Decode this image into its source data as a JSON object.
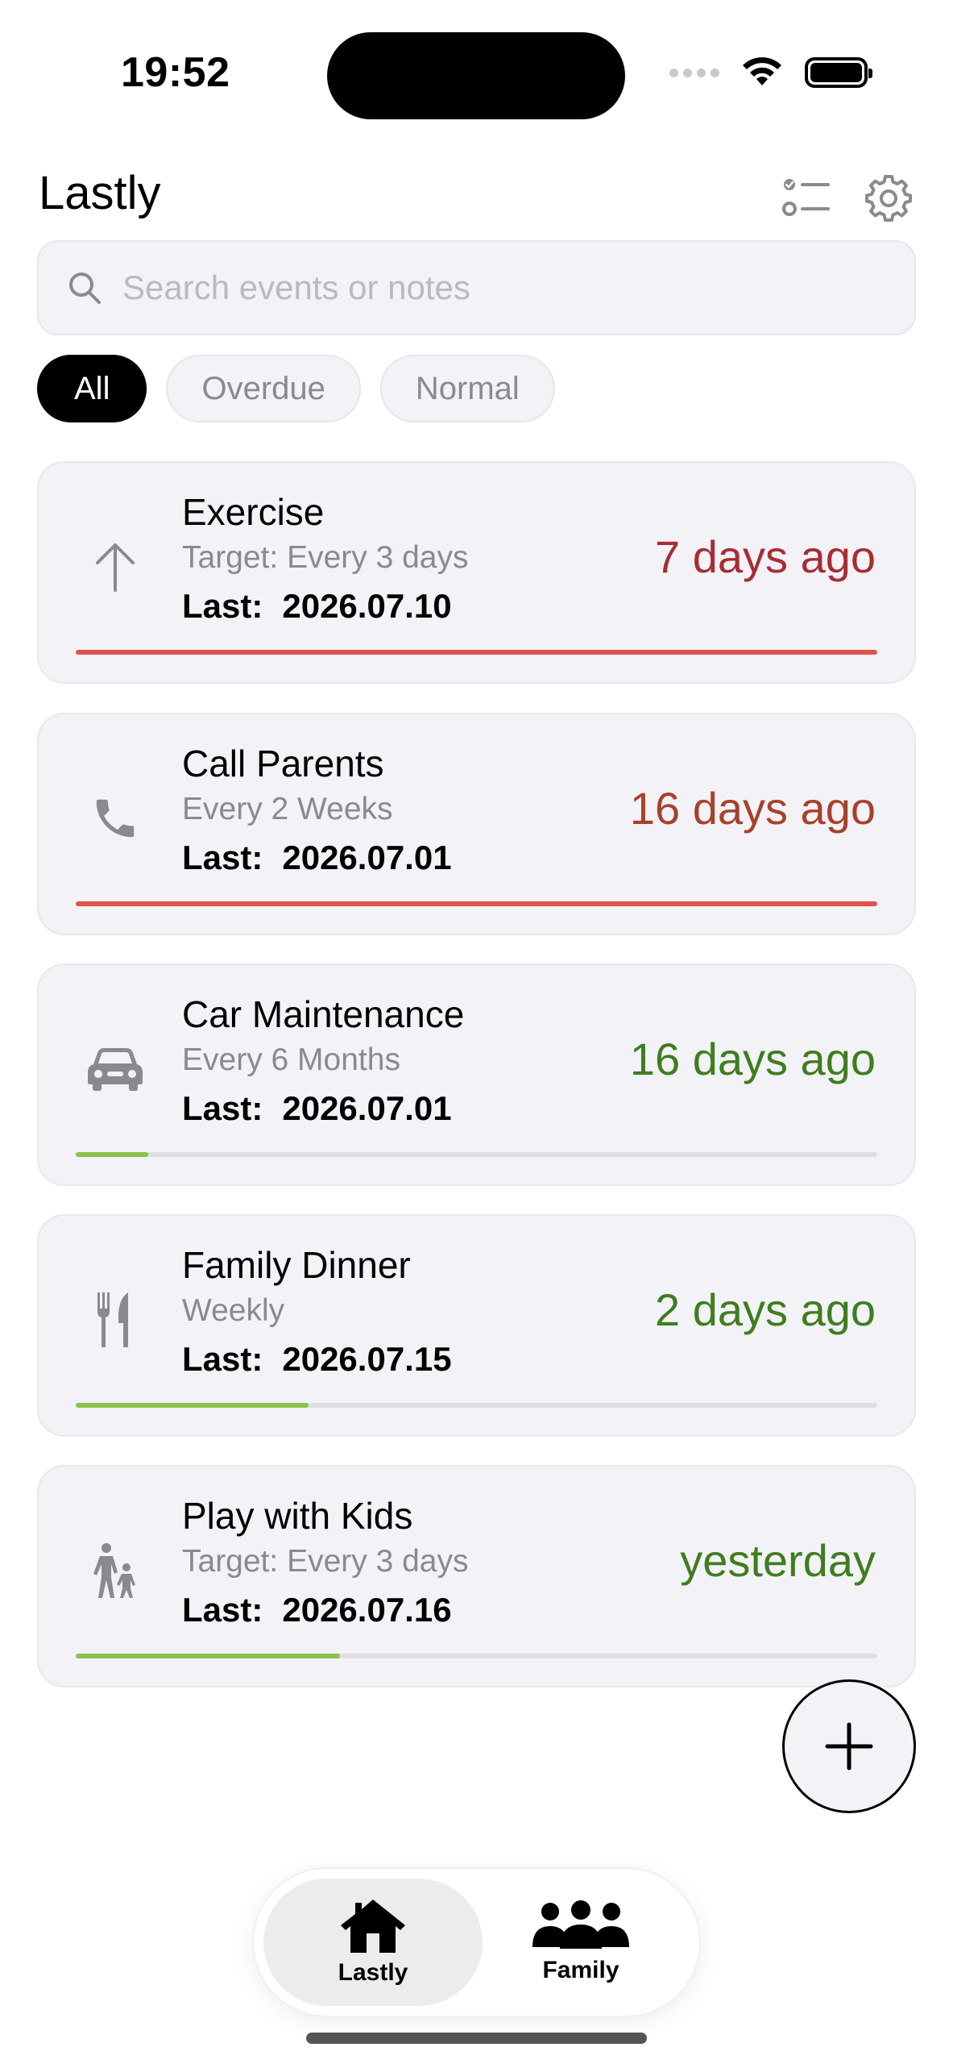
{
  "status_bar": {
    "time": "19:52"
  },
  "header": {
    "title": "Lastly",
    "list_icon": "checklist-icon",
    "settings_icon": "gear-icon"
  },
  "search": {
    "placeholder": "Search events or notes",
    "icon": "search-icon"
  },
  "filters": [
    {
      "label": "All",
      "active": true
    },
    {
      "label": "Overdue",
      "active": false
    },
    {
      "label": "Normal",
      "active": false
    }
  ],
  "events": [
    {
      "title": "Exercise",
      "frequency": "Target: Every 3 days",
      "last_label": "Last:",
      "last_date": "2026.07.10",
      "ago": "7 days ago",
      "ago_color": "#a82c34",
      "icon": "arrow-up-icon",
      "progress": 1.0,
      "progress_color": "#e0524e"
    },
    {
      "title": "Call Parents",
      "frequency": "Every 2 Weeks",
      "last_label": "Last:",
      "last_date": "2026.07.01",
      "ago": "16 days ago",
      "ago_color": "#a8402c",
      "icon": "phone-icon",
      "progress": 1.0,
      "progress_color": "#e0524e"
    },
    {
      "title": "Car Maintenance",
      "frequency": "Every 6 Months",
      "last_label": "Last:",
      "last_date": "2026.07.01",
      "ago": "16 days ago",
      "ago_color": "#3f7d1e",
      "icon": "car-icon",
      "progress": 0.09,
      "progress_color": "#8bc34a"
    },
    {
      "title": "Family Dinner",
      "frequency": "Weekly",
      "last_label": "Last:",
      "last_date": "2026.07.15",
      "ago": "2 days ago",
      "ago_color": "#3f7d1e",
      "icon": "fork-knife-icon",
      "progress": 0.29,
      "progress_color": "#8bc34a"
    },
    {
      "title": "Play with Kids",
      "frequency": "Target: Every 3 days",
      "last_label": "Last:",
      "last_date": "2026.07.16",
      "ago": "yesterday",
      "ago_color": "#3f7d1e",
      "icon": "parent-child-icon",
      "progress": 0.33,
      "progress_color": "#8bc34a"
    }
  ],
  "fab": {
    "icon": "plus-icon"
  },
  "tabbar": {
    "tabs": [
      {
        "label": "Lastly",
        "icon": "house-icon",
        "active": true
      },
      {
        "label": "Family",
        "icon": "people-icon",
        "active": false
      }
    ]
  }
}
